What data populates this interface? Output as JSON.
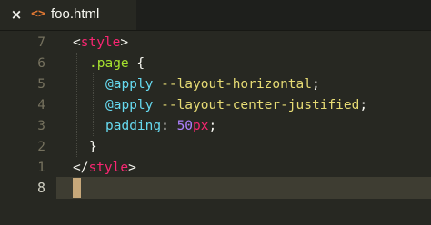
{
  "tab": {
    "close_icon": "×",
    "file_icon": "<>",
    "title": "foo.html"
  },
  "line_numbers": [
    "7",
    "6",
    "5",
    "4",
    "3",
    "2",
    "1",
    "8"
  ],
  "code": {
    "l1_open": "<",
    "l1_tag": "style",
    "l1_close": ">",
    "l2_selector": ".page",
    "l2_brace": " {",
    "l3_at": "@apply",
    "l3_ident": " --layout-horizontal",
    "l3_semi": ";",
    "l4_at": "@apply",
    "l4_ident": " --layout-center-justified",
    "l4_semi": ";",
    "l5_prop": "padding",
    "l5_colon": ": ",
    "l5_num": "50",
    "l5_unit": "px",
    "l5_semi": ";",
    "l6_brace": "}",
    "l7_open": "</",
    "l7_tag": "style",
    "l7_close": ">"
  },
  "colors": {
    "background": "#272822",
    "tag": "#f92672",
    "selector": "#a6e22e",
    "keyword": "#66d9ef",
    "number": "#ae81ff"
  }
}
